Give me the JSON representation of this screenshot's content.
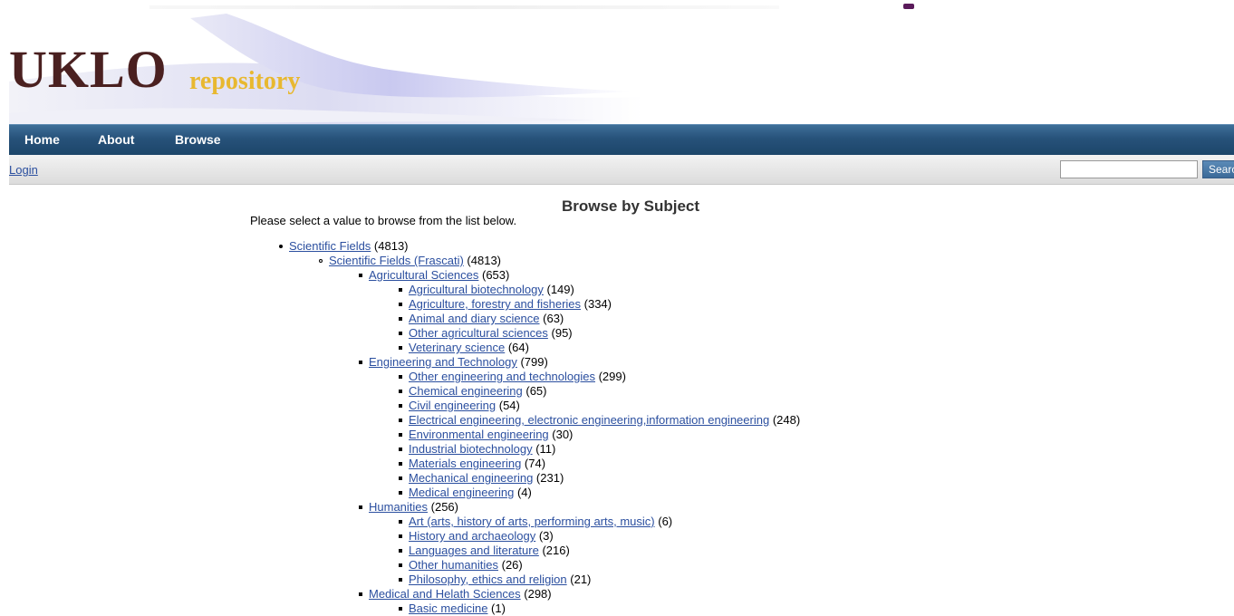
{
  "logo": {
    "main": "UKLO",
    "sub": "repository"
  },
  "nav": {
    "items": [
      "Home",
      "About",
      "Browse"
    ]
  },
  "loginbar": {
    "login": "Login",
    "search_value": "",
    "search_button": "Search"
  },
  "page": {
    "title": "Browse by Subject",
    "intro": "Please select a value to browse from the list below."
  },
  "tree": [
    {
      "label": "Scientific Fields",
      "count": " (4813)",
      "level": 0
    },
    {
      "label": "Scientific Fields (Frascati)",
      "count": " (4813)",
      "level": 1
    },
    {
      "label": "Agricultural Sciences",
      "count": " (653)",
      "level": 2
    },
    {
      "label": "Agricultural biotechnology",
      "count": " (149)",
      "level": 3
    },
    {
      "label": "Agriculture, forestry and fisheries",
      "count": " (334)",
      "level": 3
    },
    {
      "label": "Animal and diary science",
      "count": " (63)",
      "level": 3
    },
    {
      "label": "Other agricultural sciences",
      "count": " (95)",
      "level": 3
    },
    {
      "label": "Veterinary science",
      "count": " (64)",
      "level": 3
    },
    {
      "label": "Engineering and Technology",
      "count": " (799)",
      "level": 2
    },
    {
      "label": "Other engineering and technologies",
      "count": " (299)",
      "level": 3
    },
    {
      "label": "Chemical engineering",
      "count": " (65)",
      "level": 3
    },
    {
      "label": "Civil engineering",
      "count": " (54)",
      "level": 3
    },
    {
      "label": "Electrical engineering, electronic engineering,information engineering",
      "count": " (248)",
      "level": 3
    },
    {
      "label": "Environmental engineering",
      "count": " (30)",
      "level": 3
    },
    {
      "label": "Industrial biotechnology",
      "count": " (11)",
      "level": 3
    },
    {
      "label": "Materials engineering",
      "count": " (74)",
      "level": 3
    },
    {
      "label": "Mechanical engineering",
      "count": " (231)",
      "level": 3
    },
    {
      "label": "Medical engineering",
      "count": " (4)",
      "level": 3
    },
    {
      "label": "Humanities",
      "count": " (256)",
      "level": 2
    },
    {
      "label": "Art (arts, history of arts, performing arts, music)",
      "count": " (6)",
      "level": 3
    },
    {
      "label": "History and archaeology",
      "count": " (3)",
      "level": 3
    },
    {
      "label": "Languages and literature",
      "count": " (216)",
      "level": 3
    },
    {
      "label": "Other humanities",
      "count": " (26)",
      "level": 3
    },
    {
      "label": "Philosophy, ethics and religion",
      "count": " (21)",
      "level": 3
    },
    {
      "label": "Medical and Helath Sciences",
      "count": " (298)",
      "level": 2
    },
    {
      "label": "Basic medicine",
      "count": " (1)",
      "level": 3
    }
  ],
  "colors": {
    "nav_bg": "#27527a",
    "link": "#2b4f9f",
    "logo_main": "#4a2020",
    "logo_sub": "#e8b830"
  }
}
